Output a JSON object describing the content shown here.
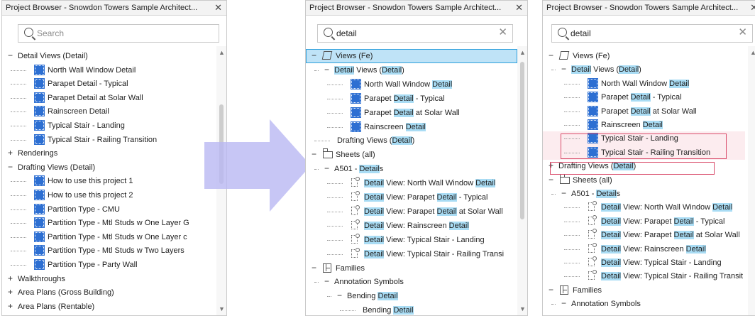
{
  "panel_title": "Project Browser - Snowdon Towers Sample Architect...",
  "close_glyph": "✕",
  "clear_glyph": "✕",
  "search_placeholder": "Search",
  "search_value": "detail",
  "panel1": {
    "rows": [
      {
        "toggle": "−",
        "label": "Detail Views (Detail)"
      },
      {
        "label": "North Wall Window Detail"
      },
      {
        "label": "Parapet Detail - Typical"
      },
      {
        "label": "Parapet Detail at Solar Wall"
      },
      {
        "label": "Rainscreen Detail"
      },
      {
        "label": "Typical Stair - Landing"
      },
      {
        "label": "Typical Stair - Railing Transition"
      },
      {
        "toggle": "+",
        "label": "Renderings"
      },
      {
        "toggle": "−",
        "label": "Drafting Views (Detail)"
      },
      {
        "label": "How to use this project 1"
      },
      {
        "label": "How to use this project 2"
      },
      {
        "label": "Partition Type - CMU"
      },
      {
        "label": "Partition Type - Mtl Studs w One Layer G"
      },
      {
        "label": "Partition Type - Mtl Studs w One Layer c"
      },
      {
        "label": "Partition Type - Mtl Studs w Two Layers"
      },
      {
        "label": "Partition Type - Party Wall"
      },
      {
        "toggle": "+",
        "label": "Walkthroughs"
      },
      {
        "toggle": "+",
        "label": "Area Plans (Gross Building)"
      },
      {
        "toggle": "+",
        "label": "Area Plans (Rentable)"
      }
    ]
  },
  "panel2": {
    "rows": [
      {
        "toggle": "−",
        "parts": [
          "Views (Fe)"
        ]
      },
      {
        "toggle": "−",
        "parts": [
          "Detail",
          " Views (",
          "Detail",
          ")"
        ]
      },
      {
        "parts": [
          "North Wall Window ",
          "Detail"
        ]
      },
      {
        "parts": [
          "Parapet ",
          "Detail",
          " - Typical"
        ]
      },
      {
        "parts": [
          "Parapet ",
          "Detail",
          " at Solar Wall"
        ]
      },
      {
        "parts": [
          "Rainscreen ",
          "Detail"
        ]
      },
      {
        "parts": [
          "Drafting Views (",
          "Detail",
          ")"
        ]
      },
      {
        "toggle": "−",
        "parts": [
          "Sheets (all)"
        ]
      },
      {
        "toggle": "−",
        "parts": [
          "A501 - ",
          "Detail",
          "s"
        ]
      },
      {
        "parts": [
          "Detail",
          " View: North Wall Window ",
          "Detail"
        ]
      },
      {
        "parts": [
          "Detail",
          " View: Parapet ",
          "Detail",
          " - Typical"
        ]
      },
      {
        "parts": [
          "Detail",
          " View: Parapet ",
          "Detail",
          " at Solar Wall"
        ]
      },
      {
        "parts": [
          "Detail",
          " View: Rainscreen ",
          "Detail"
        ]
      },
      {
        "parts": [
          "Detail",
          " View: Typical Stair - Landing"
        ]
      },
      {
        "parts": [
          "Detail",
          " View: Typical Stair - Railing Transi"
        ]
      },
      {
        "toggle": "−",
        "parts": [
          "Families"
        ]
      },
      {
        "toggle": "−",
        "parts": [
          "Annotation Symbols"
        ]
      },
      {
        "toggle": "−",
        "parts": [
          "Bending ",
          "Detail"
        ]
      },
      {
        "parts": [
          "Bending ",
          "Detail"
        ]
      }
    ]
  },
  "panel3": {
    "rows": [
      {
        "toggle": "−",
        "parts": [
          "Views (Fe)"
        ]
      },
      {
        "toggle": "−",
        "parts": [
          "Detail",
          " Views (",
          "Detail",
          ")"
        ]
      },
      {
        "parts": [
          "North Wall Window ",
          "Detail"
        ]
      },
      {
        "parts": [
          "Parapet ",
          "Detail",
          " - Typical"
        ]
      },
      {
        "parts": [
          "Parapet ",
          "Detail",
          " at Solar Wall"
        ]
      },
      {
        "parts": [
          "Rainscreen ",
          "Detail"
        ]
      },
      {
        "parts": [
          "Typical Stair - Landing"
        ]
      },
      {
        "parts": [
          "Typical Stair - Railing Transition"
        ]
      },
      {
        "toggle": "+",
        "parts": [
          "Drafting Views (",
          "Detail",
          ")"
        ]
      },
      {
        "toggle": "−",
        "parts": [
          "Sheets (all)"
        ]
      },
      {
        "toggle": "−",
        "parts": [
          "A501 - ",
          "Detail",
          "s"
        ]
      },
      {
        "parts": [
          "Detail",
          " View: North Wall Window ",
          "Detail"
        ]
      },
      {
        "parts": [
          "Detail",
          " View: Parapet ",
          "Detail",
          " - Typical"
        ]
      },
      {
        "parts": [
          "Detail",
          " View: Parapet ",
          "Detail",
          " at Solar Wall"
        ]
      },
      {
        "parts": [
          "Detail",
          " View: Rainscreen ",
          "Detail"
        ]
      },
      {
        "parts": [
          "Detail",
          " View: Typical Stair - Landing"
        ]
      },
      {
        "parts": [
          "Detail",
          " View: Typical Stair - Railing Transit"
        ]
      },
      {
        "toggle": "−",
        "parts": [
          "Families"
        ]
      },
      {
        "toggle": "−",
        "parts": [
          "Annotation Symbols"
        ]
      }
    ]
  },
  "colors": {
    "highlight": "#a9dcf4",
    "selection": "#bfe3f7",
    "selection_border": "#2fa0dc",
    "view_icon": "#2d6fd2",
    "arrow": "#b9b8f3",
    "annotation_border": "#d94b6a"
  },
  "icons": [
    "search-icon",
    "close-icon",
    "clear-icon",
    "view-icon",
    "views-icon",
    "sheets-icon",
    "sheet-view-icon",
    "families-icon"
  ]
}
